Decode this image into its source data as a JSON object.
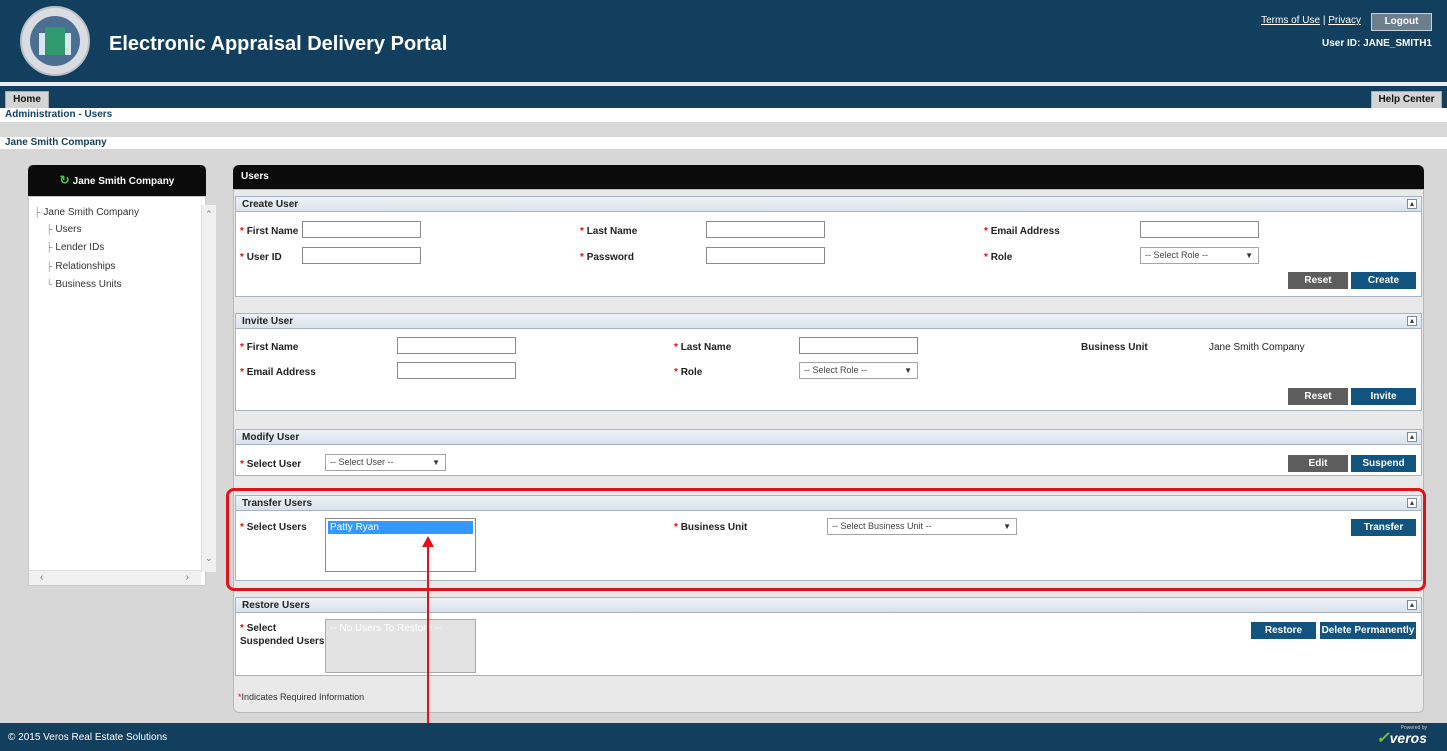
{
  "header": {
    "title": "Electronic Appraisal Delivery Portal",
    "terms_label": "Terms of Use",
    "separator": "|",
    "privacy_label": "Privacy",
    "logout_label": "Logout",
    "user_id": "User ID: JANE_SMITH1"
  },
  "tabs": {
    "home": "Home",
    "help_center": "Help Center"
  },
  "breadcrumb": "Administration - Users",
  "company_line": "Jane Smith Company",
  "tree": {
    "title": "Jane Smith Company",
    "root": "Jane Smith Company",
    "items": [
      "Users",
      "Lender IDs",
      "Relationships",
      "Business Units"
    ]
  },
  "main_title": "Users",
  "required_mark": "*",
  "create_user": {
    "title": "Create User",
    "first_name": "First Name",
    "last_name": "Last Name",
    "email": "Email Address",
    "user_id": "User ID",
    "password": "Password",
    "role": "Role",
    "role_select": "-- Select Role --",
    "reset": "Reset",
    "create": "Create"
  },
  "invite_user": {
    "title": "Invite User",
    "first_name": "First Name",
    "last_name": "Last Name",
    "business_unit_label": "Business Unit",
    "business_unit_value": "Jane Smith Company",
    "email": "Email Address",
    "role": "Role",
    "role_select": "-- Select Role --",
    "reset": "Reset",
    "invite": "Invite"
  },
  "modify_user": {
    "title": "Modify User",
    "select_user": "Select User",
    "select_placeholder": "-- Select User --",
    "edit": "Edit",
    "suspend": "Suspend"
  },
  "transfer_users": {
    "title": "Transfer Users",
    "select_users": "Select Users",
    "users": [
      "Patty Ryan"
    ],
    "business_unit": "Business Unit",
    "business_unit_select": "-- Select Business Unit --",
    "transfer": "Transfer"
  },
  "restore_users": {
    "title": "Restore Users",
    "select_label_line1": "Select",
    "select_label_line2": "Suspended Users",
    "empty_text": "-- No Users To Restore --",
    "restore": "Restore",
    "delete": "Delete Permanently"
  },
  "required_note_mark": "*",
  "required_note": "Indicates Required Information",
  "footer": {
    "copyright": "© 2015 Veros Real Estate Solutions",
    "logo_text": "veros",
    "logo_tag": "Powered by"
  }
}
